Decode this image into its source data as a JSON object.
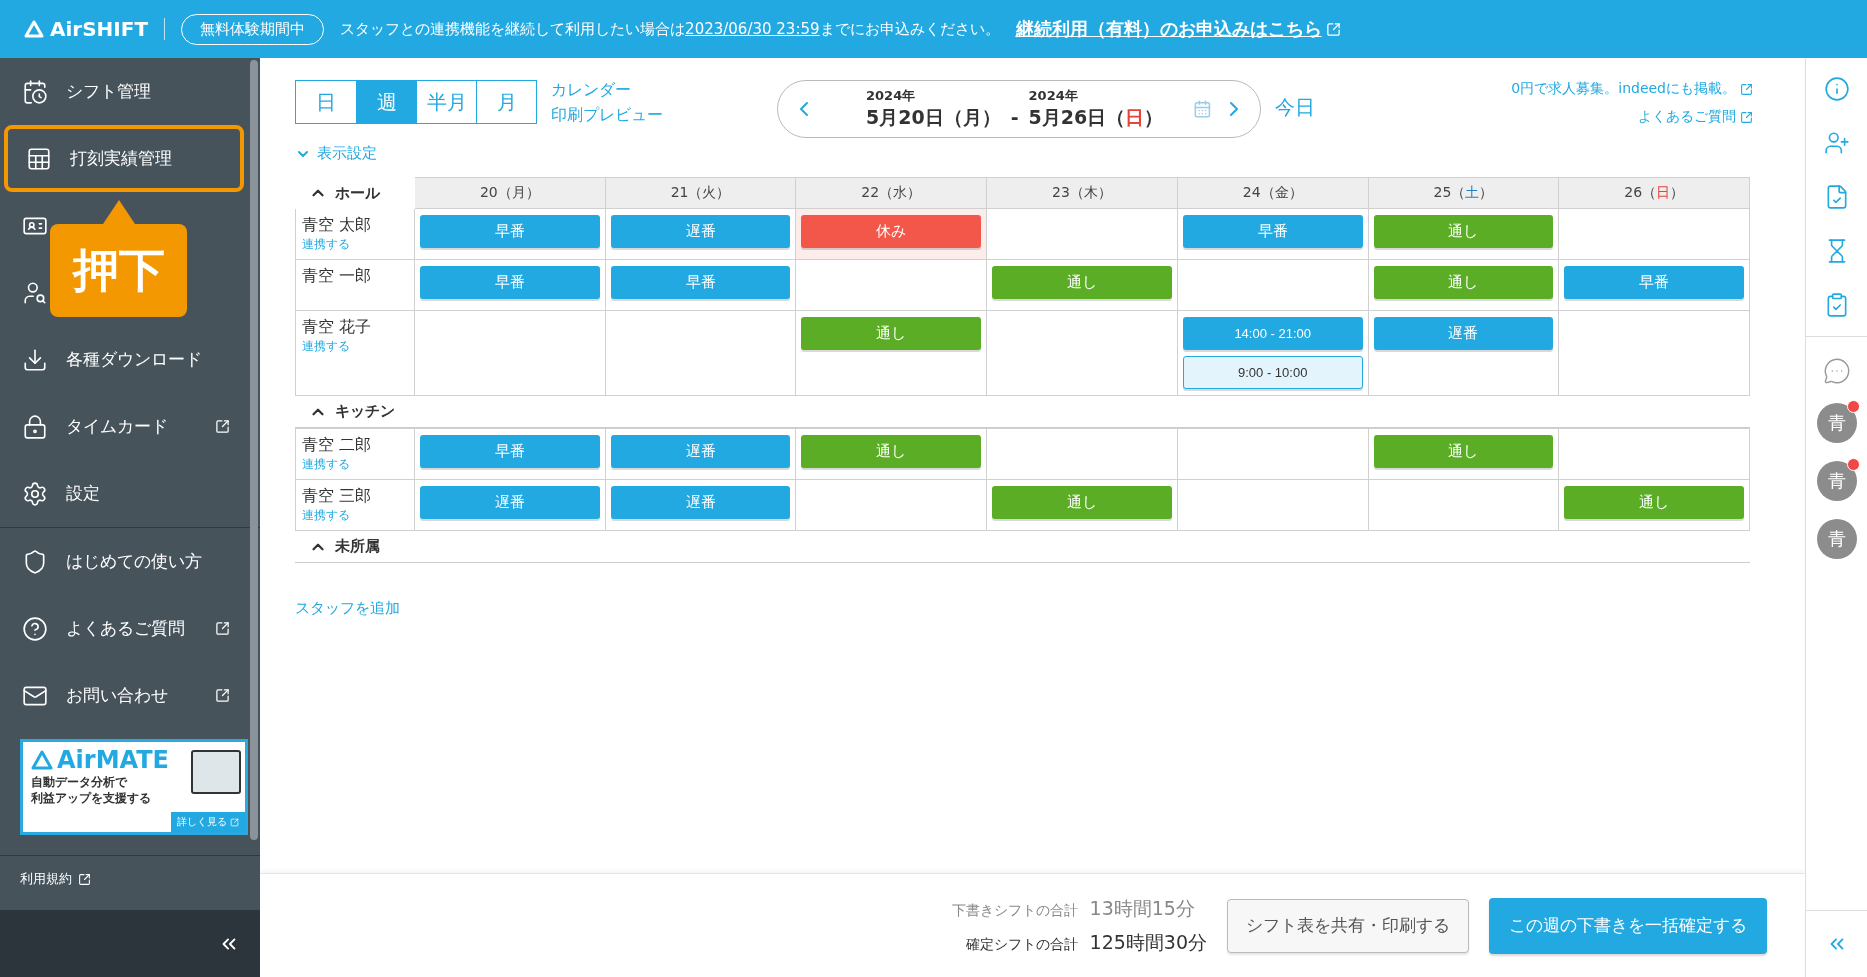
{
  "top_bar": {
    "logo": "AirSHIFT",
    "trial_badge": "無料体験期間中",
    "notice_before": "スタッフとの連携機能を継続して利用したい場合は",
    "notice_date": "2023/06/30 23:59",
    "notice_after": "までにお申込みください。",
    "apply_link": "継続利用（有料）のお申込みはこちら"
  },
  "sidebar": {
    "items": [
      {
        "label": "シフト管理",
        "external": false,
        "highlighted": false
      },
      {
        "label": "打刻実績管理",
        "external": false,
        "highlighted": true
      },
      {
        "external": false,
        "highlighted": false
      },
      {
        "external": false,
        "highlighted": false
      },
      {
        "label": "各種ダウンロード",
        "external": false,
        "highlighted": false
      },
      {
        "label": "タイムカード",
        "external": true,
        "highlighted": false
      },
      {
        "label": "設定",
        "external": false,
        "highlighted": false
      },
      {
        "label": "はじめての使い方",
        "external": false,
        "highlighted": false
      },
      {
        "label": "よくあるご質問",
        "external": true,
        "highlighted": false
      },
      {
        "label": "お問い合わせ",
        "external": true,
        "highlighted": false
      }
    ],
    "callout": "押下",
    "ad": {
      "logo": "AirMATE",
      "line_1": "自動データ分析で",
      "line_2": "利益アップを支援する",
      "button": "詳しく見る"
    },
    "terms_link": "利用規約"
  },
  "toolbar": {
    "view_tabs": [
      {
        "label": "日",
        "selected": false
      },
      {
        "label": "週",
        "selected": true
      },
      {
        "label": "半月",
        "selected": false
      },
      {
        "label": "月",
        "selected": false
      }
    ],
    "print_link_1": "カレンダー",
    "print_link_2": "印刷プレビュー",
    "range": {
      "start_year": "2024年",
      "start_date": "5月20日（月）",
      "separator": "-",
      "end_year": "2024年",
      "end_before": "5月26日（",
      "end_weekday": "日",
      "end_after": "）"
    },
    "today": "今日",
    "ad_link": "0円で求人募集。indeedにも掲載。",
    "faq_link": "よくあるご質問",
    "display_settings": "表示設定"
  },
  "days": [
    {
      "before": "20（",
      "weekday": "月",
      "after": "）",
      "kind": "weekday"
    },
    {
      "before": "21（",
      "weekday": "火",
      "after": "）",
      "kind": "weekday"
    },
    {
      "before": "22（",
      "weekday": "水",
      "after": "）",
      "kind": "weekday"
    },
    {
      "before": "23（",
      "weekday": "木",
      "after": "）",
      "kind": "weekday"
    },
    {
      "before": "24（",
      "weekday": "金",
      "after": "）",
      "kind": "weekday"
    },
    {
      "before": "25（",
      "weekday": "土",
      "after": "）",
      "kind": "sat"
    },
    {
      "before": "26（",
      "weekday": "日",
      "after": "）",
      "kind": "sun"
    }
  ],
  "sections": [
    {
      "name": "ホール",
      "expanded": true,
      "staff": [
        {
          "name": "青空 太郎",
          "link": "連携する",
          "cells": [
            [
              {
                "label": "早番",
                "kind": "early"
              }
            ],
            [
              {
                "label": "遅番",
                "kind": "late"
              }
            ],
            [
              {
                "label": "休み",
                "kind": "off"
              }
            ],
            [],
            [
              {
                "label": "早番",
                "kind": "early"
              }
            ],
            [
              {
                "label": "通し",
                "kind": "full"
              }
            ],
            []
          ]
        },
        {
          "name": "青空 一郎",
          "cells": [
            [
              {
                "label": "早番",
                "kind": "early"
              }
            ],
            [
              {
                "label": "早番",
                "kind": "early"
              }
            ],
            [],
            [
              {
                "label": "通し",
                "kind": "full"
              }
            ],
            [],
            [
              {
                "label": "通し",
                "kind": "full"
              }
            ],
            [
              {
                "label": "早番",
                "kind": "early"
              }
            ]
          ]
        },
        {
          "name": "青空 花子",
          "link": "連携する",
          "cells": [
            [],
            [],
            [
              {
                "label": "通し",
                "kind": "full"
              }
            ],
            [],
            [
              {
                "label": "14:00 - 21:00",
                "kind": "time"
              },
              {
                "label": "9:00 - 10:00",
                "kind": "request"
              }
            ],
            [
              {
                "label": "遅番",
                "kind": "late"
              }
            ],
            []
          ]
        }
      ]
    },
    {
      "name": "キッチン",
      "expanded": true,
      "staff": [
        {
          "name": "青空 二郎",
          "link": "連携する",
          "cells": [
            [
              {
                "label": "早番",
                "kind": "early"
              }
            ],
            [
              {
                "label": "遅番",
                "kind": "late"
              }
            ],
            [
              {
                "label": "通し",
                "kind": "full"
              }
            ],
            [],
            [],
            [
              {
                "label": "通し",
                "kind": "full"
              }
            ],
            []
          ]
        },
        {
          "name": "青空 三郎",
          "link": "連携する",
          "cells": [
            [
              {
                "label": "遅番",
                "kind": "late"
              }
            ],
            [
              {
                "label": "遅番",
                "kind": "late"
              }
            ],
            [],
            [
              {
                "label": "通し",
                "kind": "full"
              }
            ],
            [],
            [],
            [
              {
                "label": "通し",
                "kind": "full"
              }
            ]
          ]
        }
      ]
    },
    {
      "name": "未所属",
      "expanded": true
    }
  ],
  "add_staff": "スタッフを追加",
  "footer": {
    "draft_label": "下書きシフトの合計",
    "draft_total": "13時間15分",
    "confirmed_label": "確定シフトの合計",
    "confirmed_total": "125時間30分",
    "share_button": "シフト表を共有・印刷する",
    "confirm_button": "この週の下書きを一括確定する"
  },
  "right_rail": {
    "avatars": [
      {
        "initial": "青",
        "unread": true
      },
      {
        "initial": "青",
        "unread": true
      },
      {
        "initial": "青",
        "unread": false
      }
    ]
  }
}
